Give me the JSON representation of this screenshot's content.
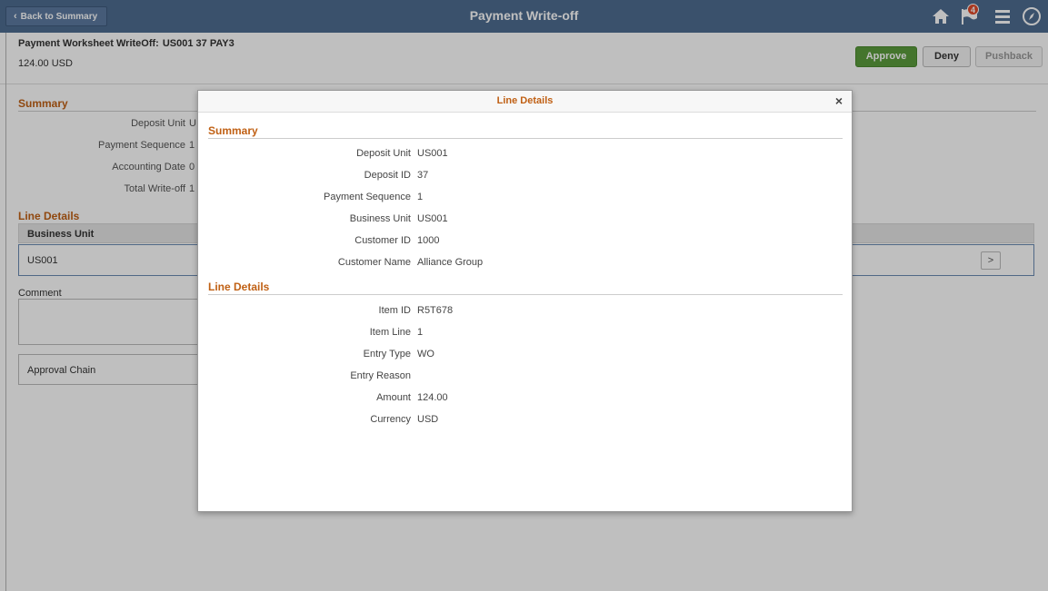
{
  "header": {
    "back_label": "Back to Summary",
    "title": "Payment Write-off",
    "icons": [
      "home-icon",
      "flag-icon",
      "menu-icon",
      "nav-icon"
    ],
    "notification_count": "4"
  },
  "worksheet": {
    "title_label": "Payment Worksheet WriteOff:",
    "title_values": "US001  37  PAY3",
    "amount": "124.00  USD"
  },
  "actions": {
    "approve": "Approve",
    "deny": "Deny",
    "pushback": "Pushback"
  },
  "background": {
    "summary_heading": "Summary",
    "summary_fields": [
      {
        "label": "Deposit Unit",
        "value": "U"
      },
      {
        "label": "Payment Sequence",
        "value": "1"
      },
      {
        "label": "Accounting Date",
        "value": "0"
      },
      {
        "label": "Total Write-off",
        "value": "1"
      }
    ],
    "line_details_heading": "Line Details",
    "grid_header": "Business Unit",
    "grid_row_value": "US001",
    "comment_label": "Comment",
    "approval_chain_label": "Approval Chain"
  },
  "modal": {
    "title": "Line Details",
    "close": "×",
    "summary_heading": "Summary",
    "summary_fields": [
      {
        "label": "Deposit Unit",
        "value": "US001"
      },
      {
        "label": "Deposit ID",
        "value": "37"
      },
      {
        "label": "Payment Sequence",
        "value": "1"
      },
      {
        "label": "Business Unit",
        "value": "US001"
      },
      {
        "label": "Customer ID",
        "value": "1000"
      },
      {
        "label": "Customer Name",
        "value": "Alliance Group"
      }
    ],
    "line_details_heading": "Line Details",
    "line_fields": [
      {
        "label": "Item ID",
        "value": "R5T678"
      },
      {
        "label": "Item Line",
        "value": "1"
      },
      {
        "label": "Entry Type",
        "value": "WO"
      },
      {
        "label": "Entry Reason",
        "value": ""
      },
      {
        "label": "Amount",
        "value": "124.00"
      },
      {
        "label": "Currency",
        "value": "USD"
      }
    ]
  },
  "colors": {
    "header_bg": "#4e6c91",
    "section_heading": "#c06014",
    "approve_bg": "#5b9c3c"
  }
}
